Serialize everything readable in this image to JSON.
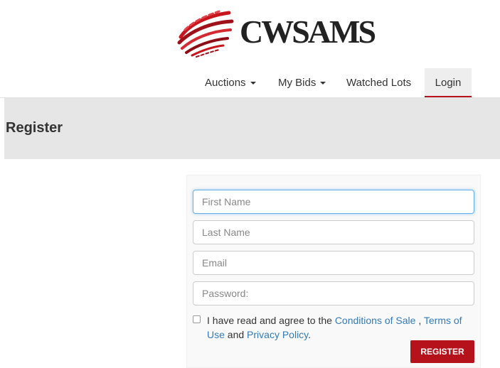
{
  "brand": {
    "name": "CWSAMS",
    "logo_icon": "cwsams-swirl-logo",
    "accent_color": "#b5121b"
  },
  "nav": {
    "items": [
      {
        "label": "Auctions",
        "has_dropdown": true
      },
      {
        "label": "My Bids",
        "has_dropdown": true
      },
      {
        "label": "Watched Lots",
        "has_dropdown": false
      },
      {
        "label": "Login",
        "has_dropdown": false,
        "active": true
      }
    ]
  },
  "page": {
    "title": "Register"
  },
  "form": {
    "first_name_placeholder": "First Name",
    "last_name_placeholder": "Last Name",
    "email_placeholder": "Email",
    "password_placeholder": "Password:",
    "agree_prefix": "I have read and agree to the",
    "conditions_link": "Conditions of Sale",
    "separator": ",",
    "terms_link": "Terms of Use",
    "conjunction": "and",
    "privacy_link": "Privacy Policy",
    "suffix": ".",
    "agree_checked": false,
    "submit_label": "REGISTER"
  }
}
